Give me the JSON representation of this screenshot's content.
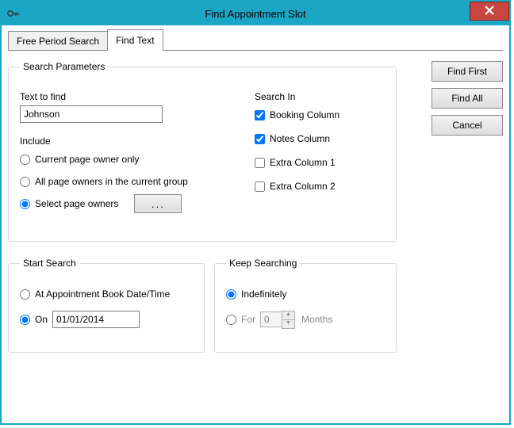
{
  "title": "Find Appointment Slot",
  "tabs": {
    "free_period": "Free Period Search",
    "find_text": "Find Text"
  },
  "buttons": {
    "find_first": "Find First",
    "find_all": "Find All",
    "cancel": "Cancel"
  },
  "search_params": {
    "legend": "Search Parameters",
    "text_to_find_label": "Text to find",
    "text_to_find_value": "Johnson",
    "include_label": "Include",
    "include_options": {
      "current": "Current page owner only",
      "all": "All page owners in the current group",
      "select": "Select page owners"
    },
    "ellipsis": "...",
    "search_in_label": "Search In",
    "search_in_options": {
      "booking": "Booking Column",
      "notes": "Notes Column",
      "extra1": "Extra Column 1",
      "extra2": "Extra Column 2"
    }
  },
  "start_search": {
    "legend": "Start Search",
    "at_book": "At Appointment Book Date/Time",
    "on": "On",
    "date_value": "01/01/2014"
  },
  "keep_searching": {
    "legend": "Keep Searching",
    "indefinitely": "Indefinitely",
    "for": "For",
    "months_value": "0",
    "months_label": "Months"
  }
}
